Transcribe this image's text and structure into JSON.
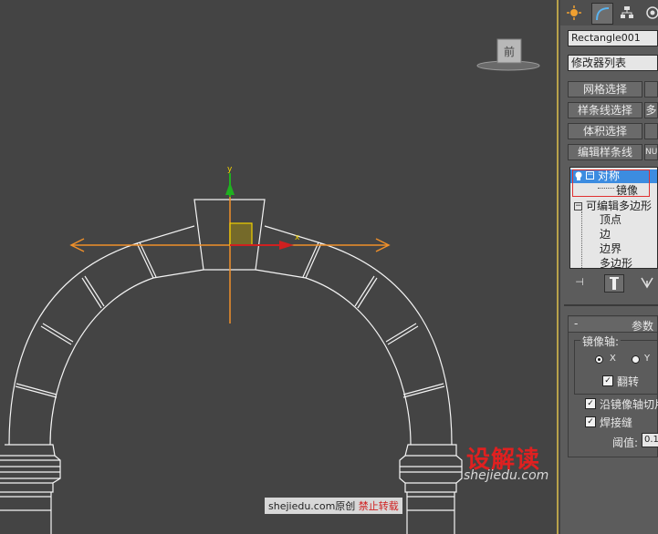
{
  "viewport": {
    "viewcube_label": "前",
    "gizmo_y_label": "y",
    "gizmo_x_label": "x"
  },
  "panel": {
    "tab_icons": [
      "create-icon",
      "modify-icon",
      "hierarchy-icon",
      "motion-icon"
    ],
    "object_name": "Rectangle001",
    "modifier_list": "修改器列表",
    "buttons": {
      "mesh_select": "网格选择",
      "spline_select": "样条线选择",
      "volume_select": "体积选择",
      "edit_spline": "编辑样条线",
      "nurbs_partial": "NUR",
      "right_partial": "多"
    },
    "stack": {
      "symmetry": "对称",
      "mirror": "镜像",
      "editable_poly": "可编辑多边形",
      "vertex": "顶点",
      "edge": "边",
      "border": "边界",
      "polygon": "多边形"
    },
    "params": {
      "collapse": "-",
      "title": "参数",
      "mirror_axis": "镜像轴:",
      "axis_x": "X",
      "axis_y": "Y",
      "flip": "翻转",
      "slice_along_mirror": "沿镜像轴切片",
      "weld_seam": "焊接缝",
      "threshold_label": "阈值:",
      "threshold_value": "0.1"
    }
  },
  "watermark": {
    "logo": "设解读",
    "site": "shejiedu.com",
    "credit_site": "shejiedu.com",
    "credit_original": "原创",
    "credit_warning": "禁止转载"
  }
}
